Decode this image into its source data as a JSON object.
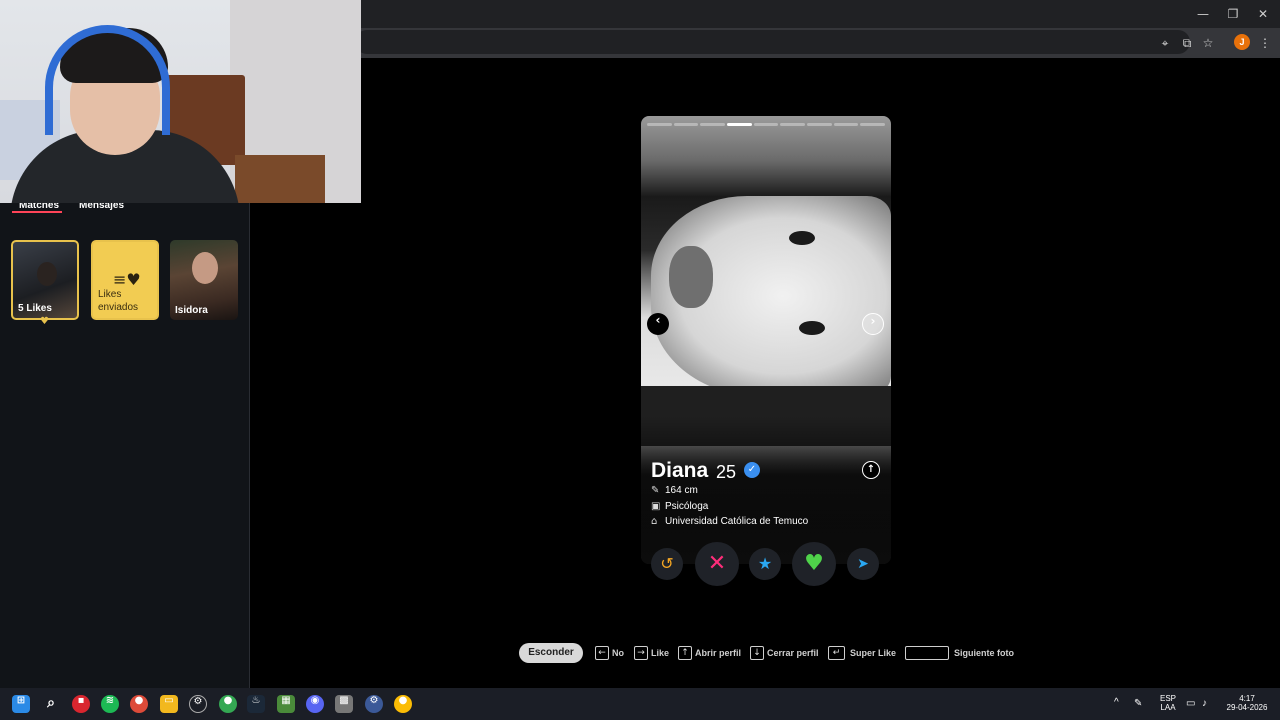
{
  "browser": {
    "window_controls": {
      "minimize": "—",
      "restore": "❐",
      "close": "✕"
    },
    "toolbar_icons": [
      "location-icon",
      "install-icon",
      "bookmark-star-icon",
      "profile-avatar",
      "menu-icon"
    ],
    "profile_initial": "J"
  },
  "sidebar": {
    "tabs": [
      {
        "label": "Matches",
        "active": true
      },
      {
        "label": "Mensajes",
        "active": false
      }
    ],
    "cards": {
      "likes": {
        "label": "5 Likes"
      },
      "likes_sent": {
        "label": "Likes enviados"
      },
      "match": {
        "name": "Isidora"
      }
    },
    "accent_color": "#ff4458",
    "gold_color": "#e8c24c"
  },
  "profile": {
    "name": "Diana",
    "age": "25",
    "verified": true,
    "photo_count": 9,
    "active_photo": 4,
    "details": [
      {
        "icon": "ruler-icon",
        "text": "164 cm"
      },
      {
        "icon": "briefcase-icon",
        "text": "Psicóloga"
      },
      {
        "icon": "graduation-cap-icon",
        "text": "Universidad Católica de Temuco"
      }
    ]
  },
  "actions": [
    {
      "name": "rewind-button",
      "icon": "rewind-icon",
      "color": "#f5a623"
    },
    {
      "name": "nope-button",
      "icon": "x-icon",
      "color": "#ff2d7a"
    },
    {
      "name": "super-like-button",
      "icon": "star-icon",
      "color": "#2aa8f2"
    },
    {
      "name": "like-button",
      "icon": "heart-icon",
      "color": "#4fd34a"
    },
    {
      "name": "boost-button",
      "icon": "send-icon",
      "color": "#2aa8f2"
    }
  ],
  "hints": {
    "hide_button": "Esconder",
    "items": [
      {
        "key": "←",
        "label": "No"
      },
      {
        "key": "→",
        "label": "Like"
      },
      {
        "key": "↑",
        "label": "Abrir perfil"
      },
      {
        "key": "↓",
        "label": "Cerrar perfil"
      },
      {
        "key": "↵",
        "label": "Super Like"
      },
      {
        "key": "",
        "label": "Siguiente foto"
      }
    ]
  },
  "taskbar": {
    "apps": [
      "windows-start-icon",
      "search-icon",
      "app-red-icon",
      "spotify-icon",
      "chrome-icon",
      "file-explorer-icon",
      "app-gear-icon",
      "chrome-active-icon",
      "steam-icon",
      "app-green-icon",
      "discord-icon",
      "minecraft-icon",
      "settings-icon",
      "chrome-alt-icon"
    ],
    "language": "ESP",
    "language_sub": "LAA",
    "time": "4:17",
    "date": "29-04-2026"
  }
}
